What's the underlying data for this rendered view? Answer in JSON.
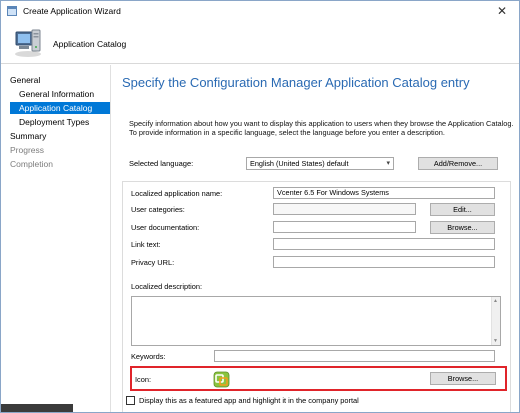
{
  "window": {
    "title": "Create Application Wizard",
    "close_glyph": "✕"
  },
  "header": {
    "title": "Application Catalog",
    "icon": "computer-wizard-icon"
  },
  "nav": {
    "items": [
      {
        "label": "General",
        "state": "normal"
      },
      {
        "label": "General Information",
        "state": "normal"
      },
      {
        "label": "Application Catalog",
        "state": "active"
      },
      {
        "label": "Deployment Types",
        "state": "normal"
      },
      {
        "label": "Summary",
        "state": "normal"
      },
      {
        "label": "Progress",
        "state": "disabled"
      },
      {
        "label": "Completion",
        "state": "disabled"
      }
    ]
  },
  "main": {
    "heading": "Specify the Configuration Manager Application Catalog entry",
    "description": "Specify information about how you want to display this application to users when they browse the Application Catalog. To provide information in a specific language, select the language before you enter a description.",
    "language": {
      "label": "Selected language:",
      "value": "English (United States) default",
      "add_remove_label": "Add/Remove..."
    },
    "fields": {
      "localized_name_label": "Localized application name:",
      "localized_name_value": "Vcenter 6.5 For Windows Systems",
      "user_categories_label": "User categories:",
      "edit_label": "Edit...",
      "user_documentation_label": "User documentation:",
      "browse_doc_label": "Browse...",
      "link_text_label": "Link text:",
      "privacy_url_label": "Privacy URL:",
      "localized_description_label": "Localized description:",
      "keywords_label": "Keywords:",
      "icon_label": "Icon:",
      "browse_icon_label": "Browse..."
    },
    "featured_checkbox": {
      "label": "Display this as a featured app and highlight it in the company portal",
      "checked": false
    }
  },
  "colors": {
    "heading": "#2a6ab3",
    "active_nav": "#0078d7",
    "highlight_border": "#e0242a"
  }
}
